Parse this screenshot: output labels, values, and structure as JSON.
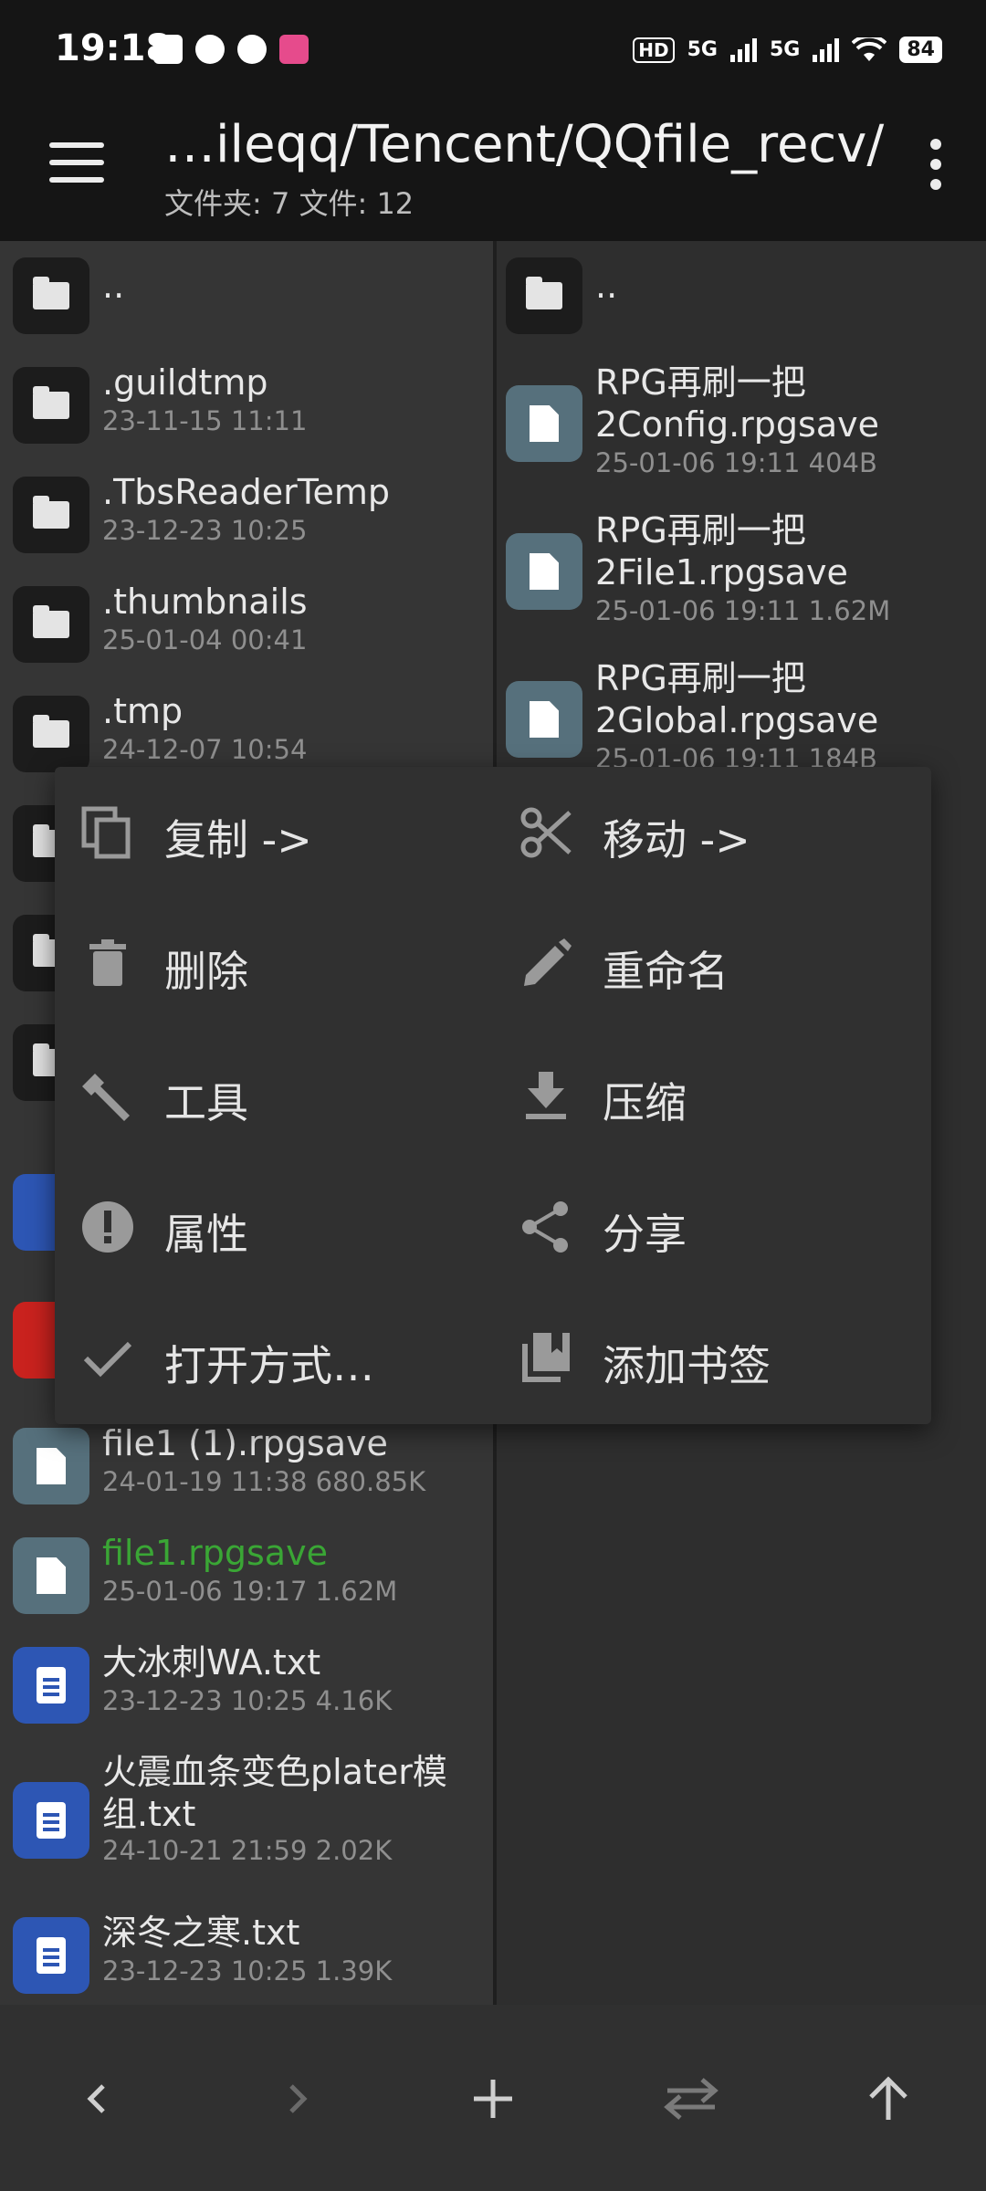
{
  "status_bar": {
    "time": "19:18",
    "hd": "HD",
    "net1": "5G",
    "net2": "5G",
    "battery": "84"
  },
  "app_bar": {
    "path": "…ileqq/Tencent/QQfile_recv/",
    "counts": "文件夹: 7  文件: 12"
  },
  "left_pane": {
    "items": [
      {
        "name": "..",
        "meta": "",
        "kind": "folder"
      },
      {
        "name": ".guildtmp",
        "meta": "23-11-15 11:11",
        "kind": "folder"
      },
      {
        "name": ".TbsReaderTemp",
        "meta": "23-12-23 10:25",
        "kind": "folder"
      },
      {
        "name": ".thumbnails",
        "meta": "25-01-04 00:41",
        "kind": "folder"
      },
      {
        "name": ".tmp",
        "meta": "24-12-07 10:54",
        "kind": "folder"
      },
      {
        "name": "file1 (1).rpgsave",
        "meta": "24-01-19 11:38  680.85K",
        "kind": "doc"
      },
      {
        "name": "file1.rpgsave",
        "meta": "25-01-06 19:17  1.62M",
        "kind": "doc",
        "highlight": "#3aa635"
      },
      {
        "name": "大冰刺WA.txt",
        "meta": "23-12-23 10:25  4.16K",
        "kind": "txt"
      },
      {
        "name": "火震血条变色plater模组.txt",
        "meta": "24-10-21 21:59  2.02K",
        "kind": "txt"
      },
      {
        "name": "深冬之寒.txt",
        "meta": "23-12-23 10:25  1.39K",
        "kind": "txt"
      }
    ]
  },
  "right_pane": {
    "items": [
      {
        "name": "..",
        "meta": "",
        "kind": "folder"
      },
      {
        "name": "RPG再刷一把2Config.rpgsave",
        "meta": "25-01-06 19:11  404B",
        "kind": "doc"
      },
      {
        "name": "RPG再刷一把2File1.rpgsave",
        "meta": "25-01-06 19:11  1.62M",
        "kind": "doc"
      },
      {
        "name": "RPG再刷一把2Global.rpgsave",
        "meta": "25-01-06 19:11  184B",
        "kind": "doc"
      }
    ]
  },
  "context_menu": {
    "items": [
      {
        "label": "复制 ->",
        "icon": "copy-icon"
      },
      {
        "label": "移动 ->",
        "icon": "cut-icon"
      },
      {
        "label": "删除",
        "icon": "delete-icon"
      },
      {
        "label": "重命名",
        "icon": "edit-icon"
      },
      {
        "label": "工具",
        "icon": "wrench-icon"
      },
      {
        "label": "压缩",
        "icon": "download-icon"
      },
      {
        "label": "属性",
        "icon": "info-icon"
      },
      {
        "label": "分享",
        "icon": "share-icon"
      },
      {
        "label": "打开方式…",
        "icon": "check-icon"
      },
      {
        "label": "添加书签",
        "icon": "bookmark-icon"
      }
    ]
  },
  "bottom_bar": {
    "icons": [
      "back-icon",
      "forward-icon",
      "add-icon",
      "swap-icon",
      "up-icon"
    ]
  },
  "colors": {
    "background": "#2b2b2b",
    "toolbar": "#151515",
    "highlight_file": "#3aa635",
    "menu": "#303030"
  }
}
